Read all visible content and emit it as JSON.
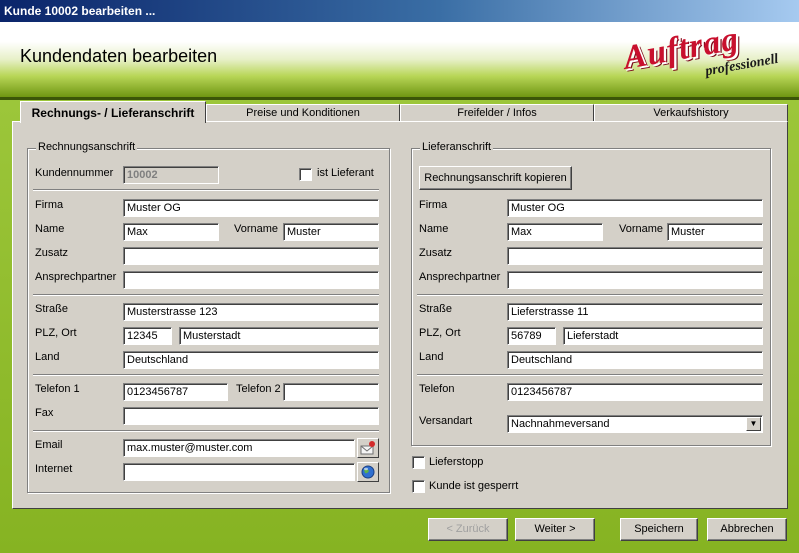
{
  "window": {
    "title": "Kunde 10002 bearbeiten ..."
  },
  "banner": {
    "title": "Kundendaten bearbeiten",
    "logo_main": "Auftrag",
    "logo_sub": "professionell"
  },
  "tabs": [
    {
      "label": "Rechnungs- /  Lieferanschrift"
    },
    {
      "label": "Preise und Konditionen"
    },
    {
      "label": "Freifelder / Infos"
    },
    {
      "label": "Verkaufshistory"
    }
  ],
  "billing": {
    "group_label": "Rechnungsanschrift",
    "kundennummer_label": "Kundennummer",
    "kundennummer": "10002",
    "ist_lieferant_label": "ist Lieferant",
    "firma_label": "Firma",
    "firma": "Muster OG",
    "name_label": "Name",
    "name": "Max",
    "vorname_label": "Vorname",
    "vorname": "Muster",
    "zusatz_label": "Zusatz",
    "zusatz": "",
    "ansprechpartner_label": "Ansprechpartner",
    "ansprechpartner": "",
    "strasse_label": "Straße",
    "strasse": "Musterstrasse 123",
    "plz_ort_label": "PLZ, Ort",
    "plz": "12345",
    "ort": "Musterstadt",
    "land_label": "Land",
    "land": "Deutschland",
    "telefon1_label": "Telefon 1",
    "telefon1": "0123456787",
    "telefon2_label": "Telefon 2",
    "telefon2": "",
    "fax_label": "Fax",
    "fax": "",
    "email_label": "Email",
    "email": "max.muster@muster.com",
    "internet_label": "Internet",
    "internet": ""
  },
  "delivery": {
    "group_label": "Lieferanschrift",
    "copy_button": "Rechnungsanschrift kopieren",
    "firma_label": "Firma",
    "firma": "Muster OG",
    "name_label": "Name",
    "name": "Max",
    "vorname_label": "Vorname",
    "vorname": "Muster",
    "zusatz_label": "Zusatz",
    "zusatz": "",
    "ansprechpartner_label": "Ansprechpartner",
    "ansprechpartner": "",
    "strasse_label": "Straße",
    "strasse": "Lieferstrasse 11",
    "plz_ort_label": "PLZ, Ort",
    "plz": "56789",
    "ort": "Lieferstadt",
    "land_label": "Land",
    "land": "Deutschland",
    "telefon_label": "Telefon",
    "telefon": "0123456787",
    "versandart_label": "Versandart",
    "versandart": "Nachnahmeversand"
  },
  "options": {
    "lieferstopp": "Lieferstopp",
    "gesperrt": "Kunde ist gesperrt"
  },
  "footer": {
    "back": "< Zurück",
    "next": "Weiter >",
    "save": "Speichern",
    "cancel": "Abbrechen"
  },
  "icons": {
    "email": "mail-icon",
    "internet": "globe-icon",
    "dropdown": "chevron-down-icon"
  },
  "colors": {
    "title_bar": "#0a246a",
    "accent_green": "#86b322",
    "logo_red": "#c8102e"
  }
}
